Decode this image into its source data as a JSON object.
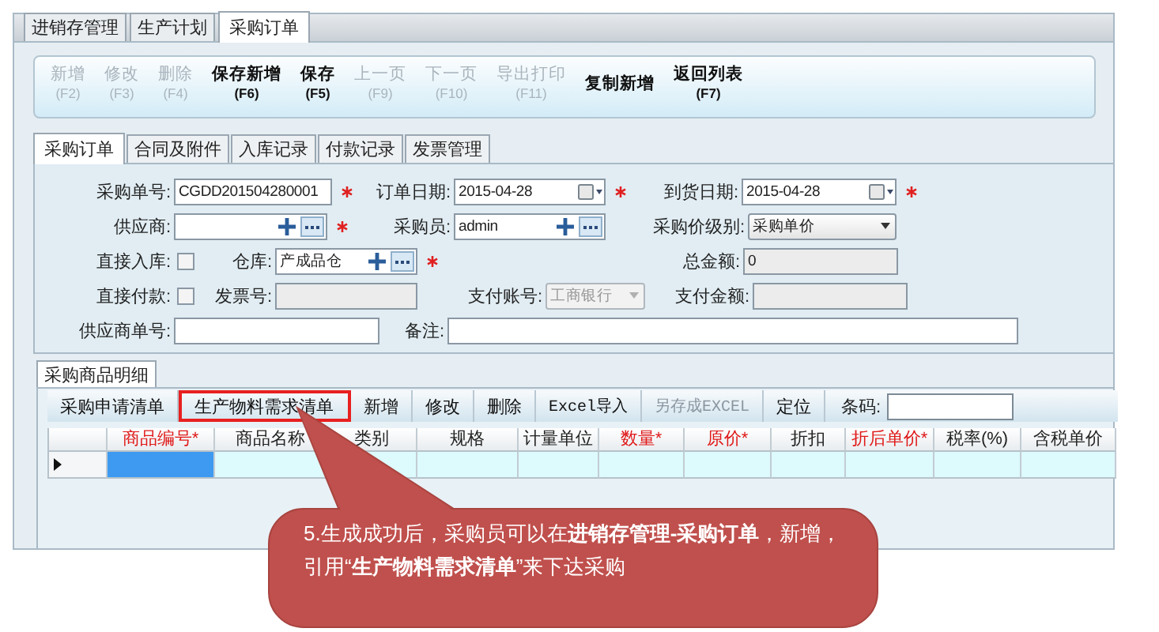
{
  "tabs": [
    {
      "label": "进销存管理",
      "selected": false
    },
    {
      "label": "生产计划",
      "selected": false
    },
    {
      "label": "采购订单",
      "selected": true
    }
  ],
  "toolbar": [
    {
      "label": "新增",
      "key": "(F2)",
      "disabled": true
    },
    {
      "label": "修改",
      "key": "(F3)",
      "disabled": true
    },
    {
      "label": "删除",
      "key": "(F4)",
      "disabled": true
    },
    {
      "label": "保存新增",
      "key": "(F6)",
      "disabled": false
    },
    {
      "label": "保存",
      "key": "(F5)",
      "disabled": false
    },
    {
      "label": "上一页",
      "key": "(F9)",
      "disabled": true
    },
    {
      "label": "下一页",
      "key": "(F10)",
      "disabled": true
    },
    {
      "label": "导出打印",
      "key": "(F11)",
      "disabled": true
    },
    {
      "label": "复制新增",
      "disabled": false
    },
    {
      "label": "返回列表",
      "key": "(F7)",
      "disabled": false
    }
  ],
  "form_tabs": [
    {
      "label": "采购订单",
      "selected": true
    },
    {
      "label": "合同及附件",
      "selected": false
    },
    {
      "label": "入库记录",
      "selected": false
    },
    {
      "label": "付款记录",
      "selected": false
    },
    {
      "label": "发票管理",
      "selected": false
    }
  ],
  "form": {
    "rows": [
      [
        {
          "label": "采购单号:",
          "kind": "text",
          "value": "CGDD201504280001",
          "required": true
        },
        {
          "label": "订单日期:",
          "kind": "date",
          "value": "2015-04-28",
          "required": true
        },
        {
          "label": "到货日期:",
          "kind": "date",
          "value": "2015-04-28",
          "required": true
        }
      ],
      [
        {
          "label": "供应商:",
          "kind": "lookup",
          "required": true
        },
        {
          "label": "采购员:",
          "kind": "lookup",
          "value": "admin",
          "required": false
        },
        {
          "label": "采购价级别:",
          "kind": "select",
          "value": "采购单价",
          "disabled": false,
          "required": false
        }
      ],
      [
        {
          "label": "直接入库:",
          "kind": "checkbox",
          "checked": false,
          "required": false
        },
        {
          "label": "仓库:",
          "kind": "lookup",
          "value": "产成品仓",
          "required": true
        },
        {
          "label": "总金额:",
          "kind": "readonly",
          "value": "0",
          "required": false
        }
      ],
      [
        {
          "label": "直接付款:",
          "kind": "checkbox",
          "checked": false,
          "required": false
        },
        {
          "label": "发票号:",
          "kind": "readonly",
          "required": false
        },
        {
          "label": "支付账号:",
          "kind": "select",
          "value": "工商银行",
          "disabled": true,
          "required": false
        },
        {
          "label": "支付金额:",
          "kind": "readonly",
          "required": false
        }
      ],
      [
        {
          "label": "供应商单号:",
          "kind": "text",
          "required": false
        },
        {
          "label": "备注:",
          "kind": "text",
          "required": false
        }
      ]
    ]
  },
  "detail_tabs": [
    {
      "label": "采购商品明细",
      "selected": true
    }
  ],
  "detail_toolbar": {
    "buttons": [
      {
        "label": "采购申请清单",
        "disabled": false,
        "highlighted": false
      },
      {
        "label": "生产物料需求清单",
        "disabled": false,
        "highlighted": true
      },
      {
        "label": "新增",
        "disabled": false,
        "highlighted": false
      },
      {
        "label": "修改",
        "disabled": false,
        "highlighted": false
      },
      {
        "label": "删除",
        "disabled": false,
        "highlighted": false
      },
      {
        "label": "Excel导入",
        "disabled": false,
        "highlighted": false
      },
      {
        "label": "另存成EXCEL",
        "disabled": true,
        "highlighted": false
      },
      {
        "label": "定位",
        "disabled": false,
        "highlighted": false
      }
    ],
    "barcode": {
      "label": "条码:"
    }
  },
  "grid": {
    "columns": [
      {
        "label": "商品编号*",
        "required": true
      },
      {
        "label": "商品名称",
        "required": false
      },
      {
        "label": "类别",
        "required": false
      },
      {
        "label": "规格",
        "required": false
      },
      {
        "label": "计量单位",
        "required": false
      },
      {
        "label": "数量*",
        "required": true
      },
      {
        "label": "原价*",
        "required": true
      },
      {
        "label": "折扣",
        "required": false
      },
      {
        "label": "折后单价*",
        "required": true
      },
      {
        "label": "税率(%)",
        "required": false
      },
      {
        "label": "含税单价",
        "required": false
      }
    ],
    "rows": [
      {
        "current": true,
        "cells": [
          {
            "selected": true
          },
          {
            "selected": false
          },
          {
            "selected": false
          },
          {
            "selected": false
          },
          {
            "selected": false
          },
          {
            "selected": false
          },
          {
            "selected": false
          },
          {
            "selected": false
          },
          {
            "selected": false
          },
          {
            "selected": false
          },
          {
            "selected": false
          }
        ]
      }
    ]
  },
  "callout": {
    "text": "5.生成成功后，采购员可以在**进销存管理-采购订单**，新增，引用“**生产物料需求清单**”来下达采购"
  }
}
